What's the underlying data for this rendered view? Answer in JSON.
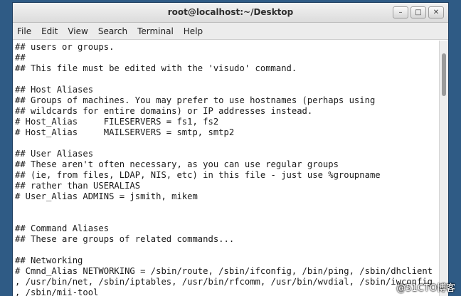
{
  "window": {
    "title": "root@localhost:~/Desktop",
    "controls": {
      "minimize": "–",
      "maximize": "□",
      "close": "✕"
    }
  },
  "menu": [
    "File",
    "Edit",
    "View",
    "Search",
    "Terminal",
    "Help"
  ],
  "terminal": {
    "lines": [
      "## users or groups.",
      "##",
      "## This file must be edited with the 'visudo' command.",
      "",
      "## Host Aliases",
      "## Groups of machines. You may prefer to use hostnames (perhaps using",
      "## wildcards for entire domains) or IP addresses instead.",
      "# Host_Alias     FILESERVERS = fs1, fs2",
      "# Host_Alias     MAILSERVERS = smtp, smtp2",
      "",
      "## User Aliases",
      "## These aren't often necessary, as you can use regular groups",
      "## (ie, from files, LDAP, NIS, etc) in this file - just use %groupname",
      "## rather than USERALIAS",
      "# User_Alias ADMINS = jsmith, mikem",
      "",
      "",
      "## Command Aliases",
      "## These are groups of related commands...",
      "",
      "## Networking",
      "# Cmnd_Alias NETWORKING = /sbin/route, /sbin/ifconfig, /bin/ping, /sbin/dhclient",
      ", /usr/bin/net, /sbin/iptables, /usr/bin/rfcomm, /usr/bin/wvdial, /sbin/iwconfig",
      ", /sbin/mii-tool"
    ]
  },
  "watermark": "@51CTO博客"
}
